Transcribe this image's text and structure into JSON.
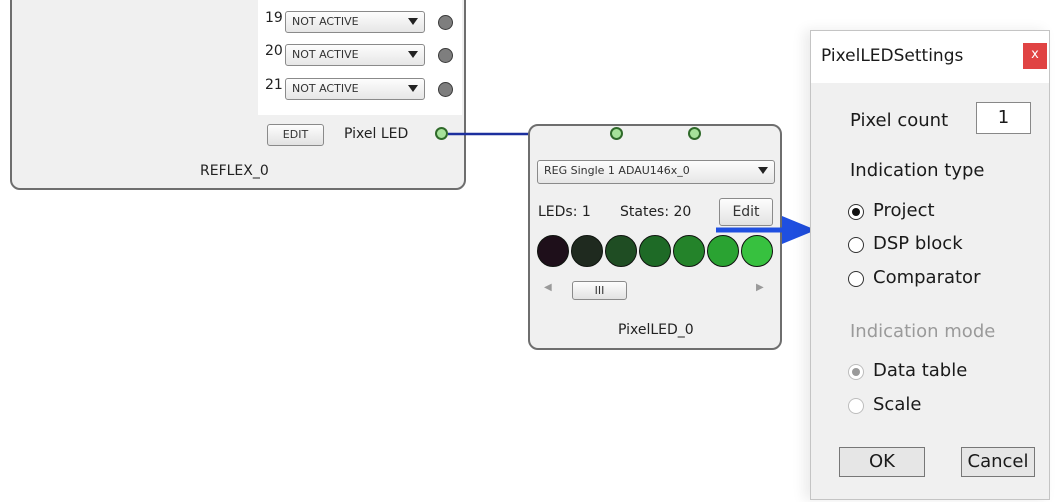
{
  "reflex": {
    "rows": [
      {
        "num": "19",
        "value": "NOT ACTIVE"
      },
      {
        "num": "20",
        "value": "NOT ACTIVE"
      },
      {
        "num": "21",
        "value": "NOT ACTIVE"
      }
    ],
    "edit_label": "EDIT",
    "pixel_led_label": "Pixel LED",
    "name": "REFLEX_0"
  },
  "pixel_led": {
    "source_value": "REG Single 1 ADAU146x_0",
    "leds_text": "LEDs: 1",
    "states_text": "States: 20",
    "edit_label": "Edit",
    "scroll_thumb": "III",
    "name": "PixelLED_0",
    "colors": [
      "#1e0f1a",
      "#1f2a1f",
      "#1f4d23",
      "#1e6a26",
      "#24832a",
      "#2aa332",
      "#37c13f"
    ]
  },
  "dialog": {
    "title": "PixelLEDSettings",
    "close_label": "x",
    "close_color": "#e04343",
    "pixel_count_label": "Pixel count",
    "pixel_count_value": "1",
    "indication_type_label": "Indication type",
    "type_options": [
      {
        "label": "Project",
        "checked": true
      },
      {
        "label": "DSP block",
        "checked": false
      },
      {
        "label": "Comparator",
        "checked": false
      }
    ],
    "indication_mode_label": "Indication mode",
    "mode_options": [
      {
        "label": "Data table",
        "checked": true
      },
      {
        "label": "Scale",
        "checked": false
      }
    ],
    "ok_label": "OK",
    "cancel_label": "Cancel"
  },
  "colors": {
    "connection_wire": "#1c2f9e",
    "pointer_arrow": "#1f4fe0"
  }
}
